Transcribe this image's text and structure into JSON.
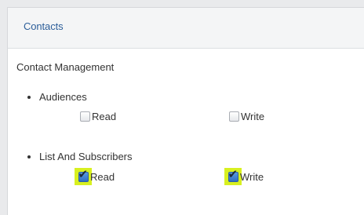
{
  "header": {
    "title": "Contacts"
  },
  "section": {
    "title": "Contact Management"
  },
  "groups": [
    {
      "label": "Audiences",
      "read_label": "Read",
      "read_checked": false,
      "write_label": "Write",
      "write_checked": false
    },
    {
      "label": "List And Subscribers",
      "read_label": "Read",
      "read_checked": true,
      "write_label": "Write",
      "write_checked": true
    }
  ],
  "colors": {
    "highlight": "#d8f020",
    "title_link": "#2d5f9a"
  }
}
